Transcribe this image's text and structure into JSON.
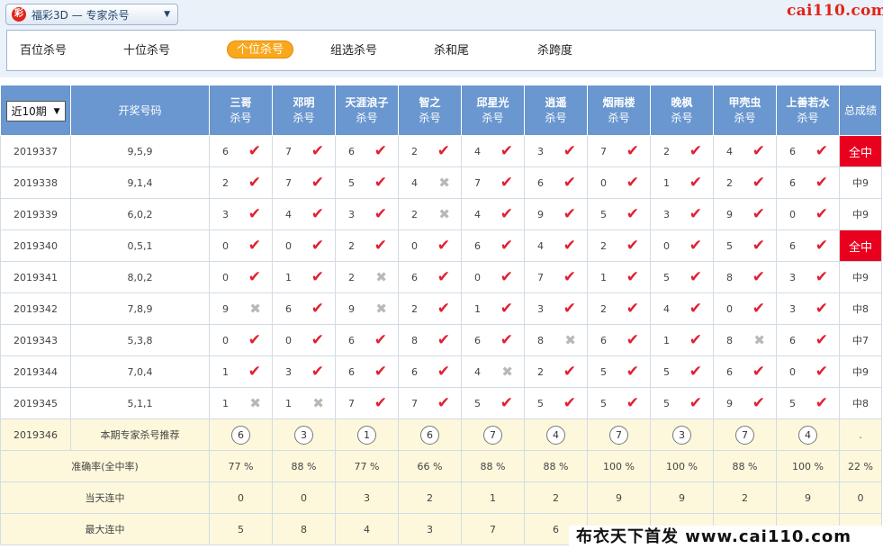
{
  "header": {
    "selector_label": "福彩3D — 专家杀号",
    "logo_glyph": "彩",
    "watermark_top": "cai110.com",
    "watermark_bottom": "布衣天下首发 www.cai110.com"
  },
  "tabs": [
    {
      "label": "百位杀号",
      "active": false
    },
    {
      "label": "十位杀号",
      "active": false
    },
    {
      "label": "个位杀号",
      "active": true
    },
    {
      "label": "组选杀号",
      "active": false
    },
    {
      "label": "杀和尾",
      "active": false
    },
    {
      "label": "杀跨度",
      "active": false
    }
  ],
  "table": {
    "range_select": "近10期",
    "col_draw": "开奖号码",
    "col_total": "总成绩",
    "sub_label": "杀号",
    "experts": [
      "三哥",
      "邓明",
      "天涯浪子",
      "智之",
      "邱星光",
      "逍遥",
      "烟雨楼",
      "晚枫",
      "甲壳虫",
      "上善若水"
    ],
    "rows": [
      {
        "period": "2019337",
        "draw": "9,5,9",
        "kills": [
          [
            "6",
            1
          ],
          [
            "7",
            1
          ],
          [
            "6",
            1
          ],
          [
            "2",
            1
          ],
          [
            "4",
            1
          ],
          [
            "3",
            1
          ],
          [
            "7",
            1
          ],
          [
            "2",
            1
          ],
          [
            "4",
            1
          ],
          [
            "6",
            1
          ]
        ],
        "total": "全中",
        "full": true
      },
      {
        "period": "2019338",
        "draw": "9,1,4",
        "kills": [
          [
            "2",
            1
          ],
          [
            "7",
            1
          ],
          [
            "5",
            1
          ],
          [
            "4",
            0
          ],
          [
            "7",
            1
          ],
          [
            "6",
            1
          ],
          [
            "0",
            1
          ],
          [
            "1",
            1
          ],
          [
            "2",
            1
          ],
          [
            "6",
            1
          ]
        ],
        "total": "中9",
        "full": false
      },
      {
        "period": "2019339",
        "draw": "6,0,2",
        "kills": [
          [
            "3",
            1
          ],
          [
            "4",
            1
          ],
          [
            "3",
            1
          ],
          [
            "2",
            0
          ],
          [
            "4",
            1
          ],
          [
            "9",
            1
          ],
          [
            "5",
            1
          ],
          [
            "3",
            1
          ],
          [
            "9",
            1
          ],
          [
            "0",
            1
          ]
        ],
        "total": "中9",
        "full": false
      },
      {
        "period": "2019340",
        "draw": "0,5,1",
        "kills": [
          [
            "0",
            1
          ],
          [
            "0",
            1
          ],
          [
            "2",
            1
          ],
          [
            "0",
            1
          ],
          [
            "6",
            1
          ],
          [
            "4",
            1
          ],
          [
            "2",
            1
          ],
          [
            "0",
            1
          ],
          [
            "5",
            1
          ],
          [
            "6",
            1
          ]
        ],
        "total": "全中",
        "full": true
      },
      {
        "period": "2019341",
        "draw": "8,0,2",
        "kills": [
          [
            "0",
            1
          ],
          [
            "1",
            1
          ],
          [
            "2",
            0
          ],
          [
            "6",
            1
          ],
          [
            "0",
            1
          ],
          [
            "7",
            1
          ],
          [
            "1",
            1
          ],
          [
            "5",
            1
          ],
          [
            "8",
            1
          ],
          [
            "3",
            1
          ]
        ],
        "total": "中9",
        "full": false
      },
      {
        "period": "2019342",
        "draw": "7,8,9",
        "kills": [
          [
            "9",
            0
          ],
          [
            "6",
            1
          ],
          [
            "9",
            0
          ],
          [
            "2",
            1
          ],
          [
            "1",
            1
          ],
          [
            "3",
            1
          ],
          [
            "2",
            1
          ],
          [
            "4",
            1
          ],
          [
            "0",
            1
          ],
          [
            "3",
            1
          ]
        ],
        "total": "中8",
        "full": false
      },
      {
        "period": "2019343",
        "draw": "5,3,8",
        "kills": [
          [
            "0",
            1
          ],
          [
            "0",
            1
          ],
          [
            "6",
            1
          ],
          [
            "8",
            1
          ],
          [
            "6",
            1
          ],
          [
            "8",
            0
          ],
          [
            "6",
            1
          ],
          [
            "1",
            1
          ],
          [
            "8",
            0
          ],
          [
            "6",
            1
          ]
        ],
        "total": "中7",
        "full": false
      },
      {
        "period": "2019344",
        "draw": "7,0,4",
        "kills": [
          [
            "1",
            1
          ],
          [
            "3",
            1
          ],
          [
            "6",
            1
          ],
          [
            "6",
            1
          ],
          [
            "4",
            0
          ],
          [
            "2",
            1
          ],
          [
            "5",
            1
          ],
          [
            "5",
            1
          ],
          [
            "6",
            1
          ],
          [
            "0",
            1
          ]
        ],
        "total": "中9",
        "full": false
      },
      {
        "period": "2019345",
        "draw": "5,1,1",
        "kills": [
          [
            "1",
            0
          ],
          [
            "1",
            0
          ],
          [
            "7",
            1
          ],
          [
            "7",
            1
          ],
          [
            "5",
            1
          ],
          [
            "5",
            1
          ],
          [
            "5",
            1
          ],
          [
            "5",
            1
          ],
          [
            "9",
            1
          ],
          [
            "5",
            1
          ]
        ],
        "total": "中8",
        "full": false
      }
    ],
    "recommend": {
      "period": "2019346",
      "label": "本期专家杀号推荐",
      "values": [
        "6",
        "3",
        "1",
        "6",
        "7",
        "4",
        "7",
        "3",
        "7",
        "4"
      ],
      "total": "."
    },
    "stats": [
      {
        "label": "准确率(全中率)",
        "values": [
          "77 %",
          "88 %",
          "77 %",
          "66 %",
          "88 %",
          "88 %",
          "100 %",
          "100 %",
          "88 %",
          "100 %"
        ],
        "total": "22 %"
      },
      {
        "label": "当天连中",
        "values": [
          "0",
          "0",
          "3",
          "2",
          "1",
          "2",
          "9",
          "9",
          "2",
          "9"
        ],
        "total": "0"
      },
      {
        "label": "最大连中",
        "values": [
          "5",
          "8",
          "4",
          "3",
          "7",
          "6",
          "",
          "",
          "",
          "",
          ""
        ],
        "total": ""
      }
    ]
  },
  "colors": {
    "header_blue": "#6a97cf",
    "hit_red": "#e9001f",
    "check_red": "#e0202f",
    "active_tab": "#f9a71c",
    "stat_bg": "#fdf8dc"
  }
}
